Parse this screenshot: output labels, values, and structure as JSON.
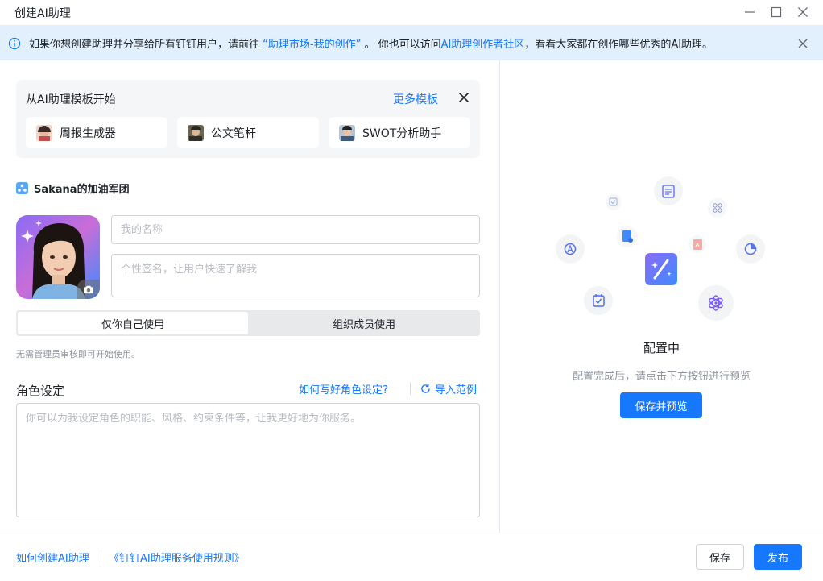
{
  "window": {
    "title": "创建AI助理"
  },
  "notice": {
    "text_1": "如果你想创建助理并分享给所有钉钉用户，请前往 ",
    "link_1": "“助理市场-我的创作”",
    "text_2": " 。 你也可以访问",
    "link_2": "AI助理创作者社区",
    "text_3": "，看看大家都在创作哪些优秀的AI助理。"
  },
  "templates": {
    "heading": "从AI助理模板开始",
    "more_label": "更多模板",
    "items": [
      {
        "label": "周报生成器"
      },
      {
        "label": "公文笔杆"
      },
      {
        "label": "SWOT分析助手"
      }
    ]
  },
  "org": {
    "name": "Sakana的加油军团"
  },
  "profile": {
    "name_placeholder": "我的名称",
    "bio_placeholder": "个性签名，让用户快速了解我"
  },
  "visibility": {
    "options": [
      {
        "label": "仅你自己使用",
        "selected": true
      },
      {
        "label": "组织成员使用",
        "selected": false
      }
    ],
    "hint": "无需管理员审核即可开始使用。"
  },
  "role": {
    "title": "角色设定",
    "help_link": "如何写好角色设定?",
    "import_label": "导入范例",
    "placeholder": "你可以为我设定角色的职能、风格、约束条件等，让我更好地为你服务。"
  },
  "preview": {
    "status": "配置中",
    "subtitle": "配置完成后，请点击下方按钮进行预览",
    "button": "保存并预览"
  },
  "footer": {
    "link_how": "如何创建AI助理",
    "link_rules": "《钉钉AI助理服务使用规则》",
    "save": "保存",
    "publish": "发布"
  },
  "colors": {
    "accent": "#1677ff",
    "banner_bg": "#e1f0fc",
    "gradient_start": "#8b6cf6",
    "gradient_end": "#3d8bff"
  }
}
